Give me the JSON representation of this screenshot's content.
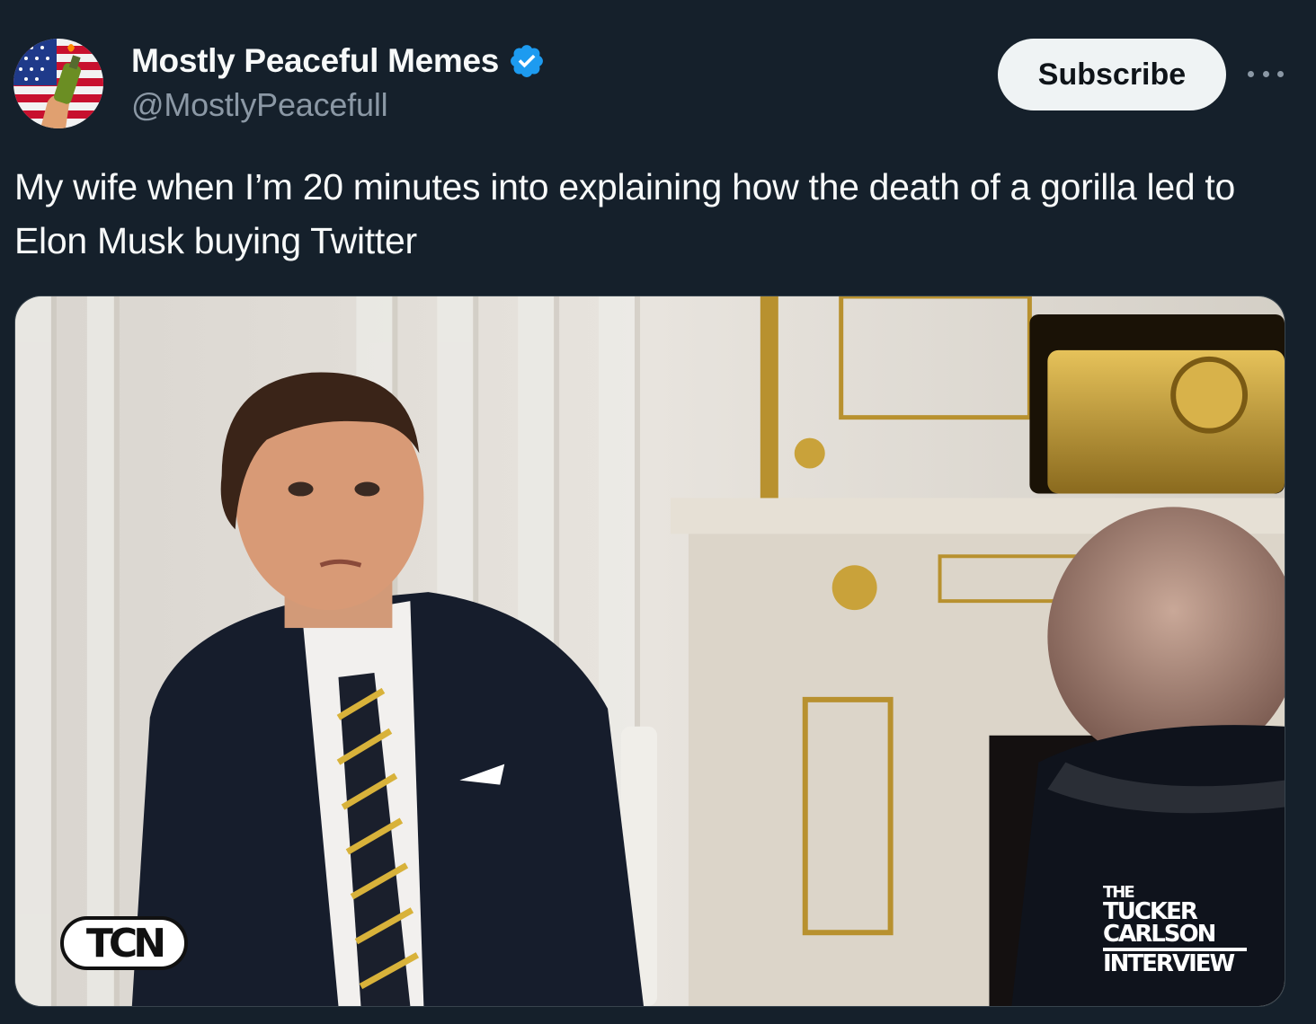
{
  "author": {
    "display_name": "Mostly Peaceful Memes",
    "handle": "@MostlyPeacefull",
    "verified": true,
    "avatar_icon": "avatar-flag-hand-bottle"
  },
  "actions": {
    "subscribe_label": "Subscribe",
    "more_icon": "more-horizontal-icon"
  },
  "post": {
    "text": "My wife when I’m 20 minutes into explaining how the death of a gorilla led to Elon Musk buying Twitter"
  },
  "media": {
    "logo_left": "TCN",
    "logo_right_lines": [
      "THE",
      "TUCKER",
      "CARLSON",
      "INTERVIEW"
    ]
  },
  "colors": {
    "background": "#15202b",
    "text_primary": "#f7f9f9",
    "text_secondary": "#8b98a5",
    "verified_blue": "#1d9bf0",
    "subscribe_bg": "#eff3f4"
  }
}
